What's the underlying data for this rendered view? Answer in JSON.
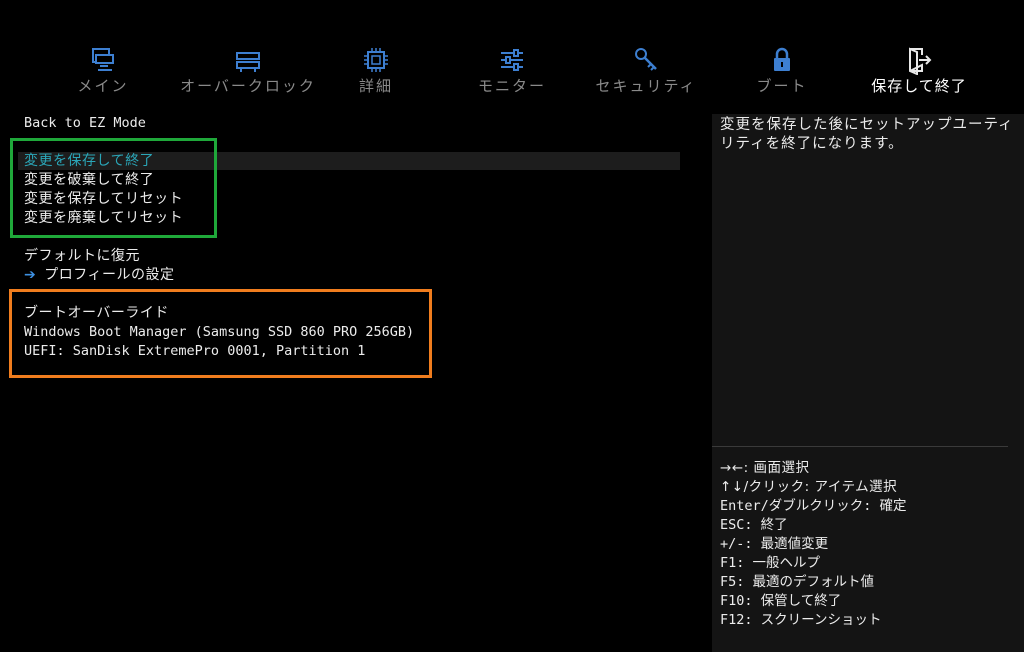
{
  "tabs": [
    {
      "label": "メイン",
      "icon": "monitor-pc-icon"
    },
    {
      "label": "オーバークロック",
      "icon": "memory-module-icon"
    },
    {
      "label": "詳細",
      "icon": "cpu-chip-icon"
    },
    {
      "label": "モニター",
      "icon": "sliders-icon"
    },
    {
      "label": "セキュリティ",
      "icon": "key-icon"
    },
    {
      "label": "ブート",
      "icon": "lock-icon"
    },
    {
      "label": "保存して終了",
      "icon": "exit-door-icon",
      "active": true
    }
  ],
  "menu": {
    "back_to_ez": "Back to EZ Mode",
    "save_exit": "変更を保存して終了",
    "discard_exit": "変更を破棄して終了",
    "save_reset": "変更を保存してリセット",
    "discard_reset": "変更を廃棄してリセット",
    "restore_defaults": "デフォルトに復元",
    "profile_settings": "プロフィールの設定",
    "boot_override_title": "ブートオーバーライド",
    "boot_option_1": "Windows Boot Manager (Samsung SSD 860 PRO 256GB)",
    "boot_option_2": "UEFI: SanDisk ExtremePro 0001, Partition 1"
  },
  "help": {
    "description": "変更を保存した後にセットアップユーティリティを終了になります。",
    "keys": [
      "→←: 画面選択",
      "↑↓/クリック: アイテム選択",
      "Enter/ダブルクリック: 確定",
      "ESC: 終了",
      "+/-: 最適値変更",
      "F1: 一般ヘルプ",
      "F5: 最適のデフォルト値",
      "F10: 保管して終了",
      "F12: スクリーンショット"
    ]
  },
  "colors": {
    "background": "#000000",
    "selected_text": "#2aa6b8",
    "icon": "#3d7fd1",
    "green_box": "#1fa83a",
    "orange_box": "#f07d1e"
  }
}
